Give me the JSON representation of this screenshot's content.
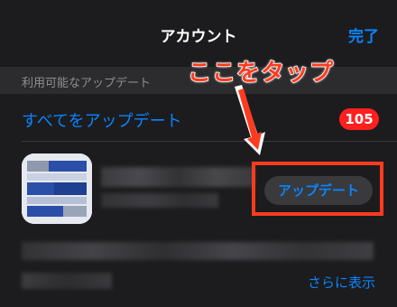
{
  "header": {
    "title": "アカウント",
    "done_label": "完了"
  },
  "section": {
    "label": "利用可能なアップデート"
  },
  "update_all": {
    "label": "すべてをアップデート",
    "badge_count": "105"
  },
  "app": {
    "update_button_label": "アップデート",
    "icon_colors": {
      "blue": "#2b4fa8",
      "light": "#dde3f0",
      "gray": "#9aa4b8"
    }
  },
  "more_link": "さらに表示",
  "annotation": {
    "text": "ここをタップ",
    "color": "#ff3b1f"
  },
  "colors": {
    "background": "#1c1c1e",
    "accent": "#0a84ff",
    "badge": "#ff1f1f"
  }
}
